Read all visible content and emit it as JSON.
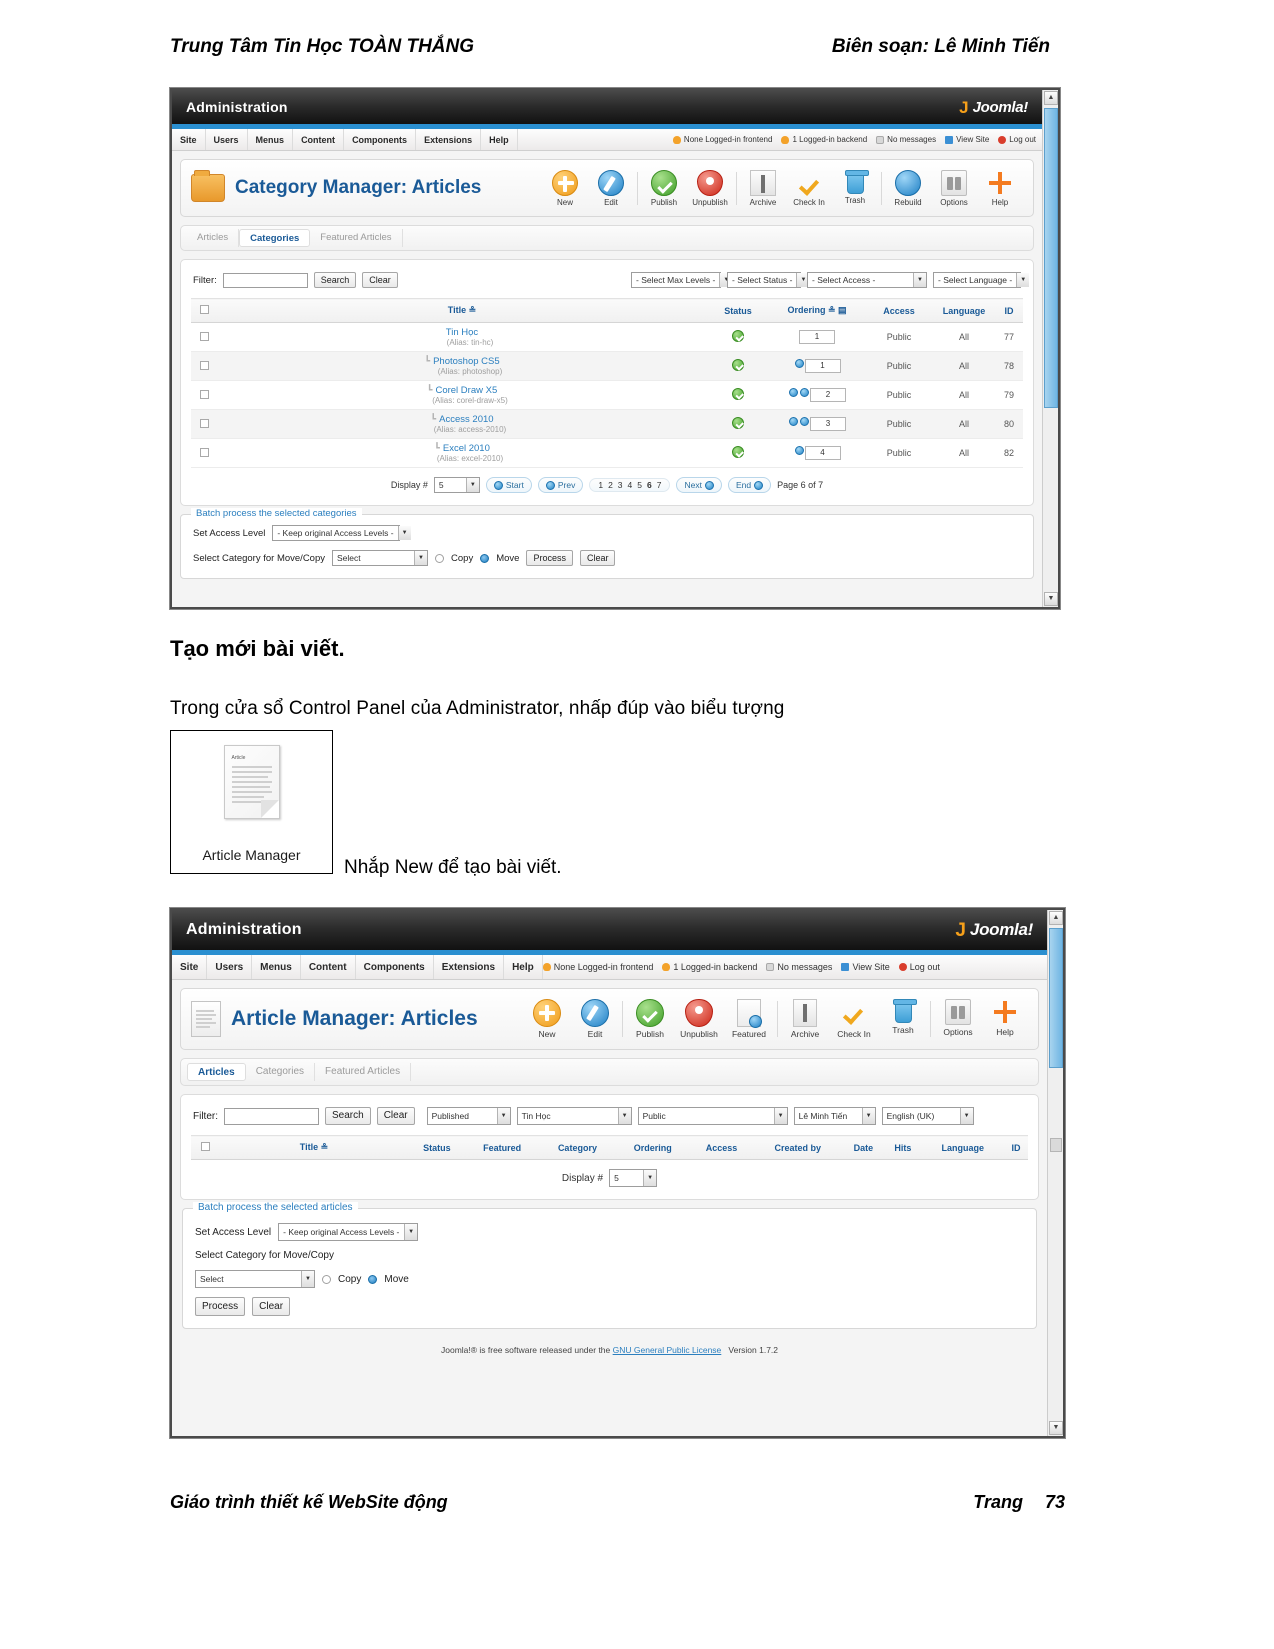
{
  "document": {
    "header_left": "Trung Tâm Tin Học TOÀN THẮNG",
    "header_right": "Biên soạn: Lê Minh Tiến",
    "footer_left": "Giáo trình thiết kế WebSite động",
    "footer_page_label": "Trang",
    "footer_page_number": "73",
    "section_heading": "Tạo mới bài viết.",
    "paragraph_1": "Trong cửa sổ Control Panel của Administrator, nhấp đúp vào biểu tượng",
    "paragraph_2": "Nhắp New để tạo bài viết.",
    "icon_box_caption": "Article Manager",
    "icon_box_paper_title": "Article"
  },
  "shot1": {
    "topbar": {
      "admin_label": "Administration",
      "brand": "Joomla!",
      "brand_mark": "J"
    },
    "menu": [
      "Site",
      "Users",
      "Menus",
      "Content",
      "Components",
      "Extensions",
      "Help"
    ],
    "status": [
      {
        "icon": "user-icon",
        "label": "None Logged-in frontend"
      },
      {
        "icon": "user-icon",
        "label": "1 Logged-in backend"
      },
      {
        "icon": "message-icon",
        "label": "No messages"
      },
      {
        "icon": "site-icon",
        "label": "View Site"
      },
      {
        "icon": "logout-icon",
        "label": "Log out"
      }
    ],
    "page_title": "Category Manager: Articles",
    "page_icon": "folder-icon",
    "toolbar": [
      {
        "name": "new",
        "label": "New"
      },
      {
        "name": "edit",
        "label": "Edit"
      },
      {
        "name": "publish",
        "label": "Publish"
      },
      {
        "name": "unpublish",
        "label": "Unpublish"
      },
      {
        "name": "archive",
        "label": "Archive"
      },
      {
        "name": "checkin",
        "label": "Check In"
      },
      {
        "name": "trash",
        "label": "Trash"
      },
      {
        "name": "rebuild",
        "label": "Rebuild"
      },
      {
        "name": "options",
        "label": "Options"
      },
      {
        "name": "help",
        "label": "Help"
      }
    ],
    "tabs": [
      {
        "label": "Articles",
        "active": false
      },
      {
        "label": "Categories",
        "active": true
      },
      {
        "label": "Featured Articles",
        "active": false
      }
    ],
    "filter": {
      "label": "Filter:",
      "value": "",
      "search_label": "Search",
      "clear_label": "Clear",
      "selects": [
        "- Select Max Levels -",
        "- Select Status -",
        "- Select Access -",
        "- Select Language -"
      ]
    },
    "table": {
      "columns": [
        "",
        "Title",
        "Status",
        "Ordering",
        "Access",
        "Language",
        "ID"
      ],
      "rows": [
        {
          "title": "Tin Học",
          "alias": "(Alias: tin-hc)",
          "level": 0,
          "status": "published",
          "arrows": 0,
          "order": "1",
          "access": "Public",
          "language": "All",
          "id": "77"
        },
        {
          "title": "Photoshop CS5",
          "alias": "(Alias: photoshop)",
          "level": 1,
          "status": "published",
          "arrows": 1,
          "order": "1",
          "access": "Public",
          "language": "All",
          "id": "78"
        },
        {
          "title": "Corel Draw X5",
          "alias": "(Alias: corel-draw-x5)",
          "level": 1,
          "status": "published",
          "arrows": 2,
          "order": "2",
          "access": "Public",
          "language": "All",
          "id": "79"
        },
        {
          "title": "Access 2010",
          "alias": "(Alias: access-2010)",
          "level": 1,
          "status": "published",
          "arrows": 2,
          "order": "3",
          "access": "Public",
          "language": "All",
          "id": "80"
        },
        {
          "title": "Excel 2010",
          "alias": "(Alias: excel-2010)",
          "level": 1,
          "status": "published",
          "arrows": 1,
          "order": "4",
          "access": "Public",
          "language": "All",
          "id": "82"
        }
      ]
    },
    "pagination": {
      "display_label": "Display #",
      "display_value": "5",
      "start": "Start",
      "prev": "Prev",
      "numbers": [
        "1",
        "2",
        "3",
        "4",
        "5",
        "6",
        "7"
      ],
      "current": "6",
      "next": "Next",
      "end": "End",
      "page_info": "Page 6 of 7"
    },
    "batch": {
      "legend": "Batch process the selected categories",
      "access_label": "Set Access Level",
      "access_value": "- Keep original Access Levels -",
      "category_label": "Select Category for Move/Copy",
      "category_value": "Select",
      "copy_label": "Copy",
      "move_label": "Move",
      "process_label": "Process",
      "clear_label": "Clear"
    }
  },
  "shot2": {
    "topbar": {
      "admin_label": "Administration",
      "brand": "Joomla!",
      "brand_mark": "J"
    },
    "menu": [
      "Site",
      "Users",
      "Menus",
      "Content",
      "Components",
      "Extensions",
      "Help"
    ],
    "status": [
      {
        "icon": "user-icon",
        "label": "None Logged-in frontend"
      },
      {
        "icon": "user-icon",
        "label": "1 Logged-in backend"
      },
      {
        "icon": "message-icon",
        "label": "No messages"
      },
      {
        "icon": "site-icon",
        "label": "View Site"
      },
      {
        "icon": "logout-icon",
        "label": "Log out"
      }
    ],
    "page_title": "Article Manager: Articles",
    "page_icon": "article-icon",
    "toolbar": [
      {
        "name": "new",
        "label": "New"
      },
      {
        "name": "edit",
        "label": "Edit"
      },
      {
        "name": "publish",
        "label": "Publish"
      },
      {
        "name": "unpublish",
        "label": "Unpublish"
      },
      {
        "name": "featured",
        "label": "Featured"
      },
      {
        "name": "archive",
        "label": "Archive"
      },
      {
        "name": "checkin",
        "label": "Check In"
      },
      {
        "name": "trash",
        "label": "Trash"
      },
      {
        "name": "options",
        "label": "Options"
      },
      {
        "name": "help",
        "label": "Help"
      }
    ],
    "tabs": [
      {
        "label": "Articles",
        "active": true
      },
      {
        "label": "Categories",
        "active": false
      },
      {
        "label": "Featured Articles",
        "active": false
      }
    ],
    "filter": {
      "label": "Filter:",
      "value": "",
      "search_label": "Search",
      "clear_label": "Clear",
      "selects": [
        "Published",
        "Tin Học",
        "Public",
        "Lê Minh Tiến",
        "English (UK)"
      ]
    },
    "table": {
      "columns": [
        "",
        "Title",
        "Status",
        "Featured",
        "Category",
        "Ordering",
        "Access",
        "Created by",
        "Date",
        "Hits",
        "Language",
        "ID"
      ],
      "rows": []
    },
    "pagination": {
      "display_label": "Display #",
      "display_value": "5"
    },
    "batch": {
      "legend": "Batch process the selected articles",
      "access_label": "Set Access Level",
      "access_value": "- Keep original Access Levels -",
      "category_label": "Select Category for Move/Copy",
      "category_value": "Select",
      "copy_label": "Copy",
      "move_label": "Move",
      "process_label": "Process",
      "clear_label": "Clear"
    },
    "footer": {
      "prefix": "Joomla!®",
      "text": " is free software released under the ",
      "link": "GNU General Public License",
      "version": "Version 1.7.2"
    }
  },
  "colors": {
    "joomla_blue": "#1a5a97",
    "link_blue": "#2b7fbf",
    "accent_orange": "#f6a01a",
    "publish_green": "#3f9e27",
    "unpublish_red": "#cc2516"
  }
}
